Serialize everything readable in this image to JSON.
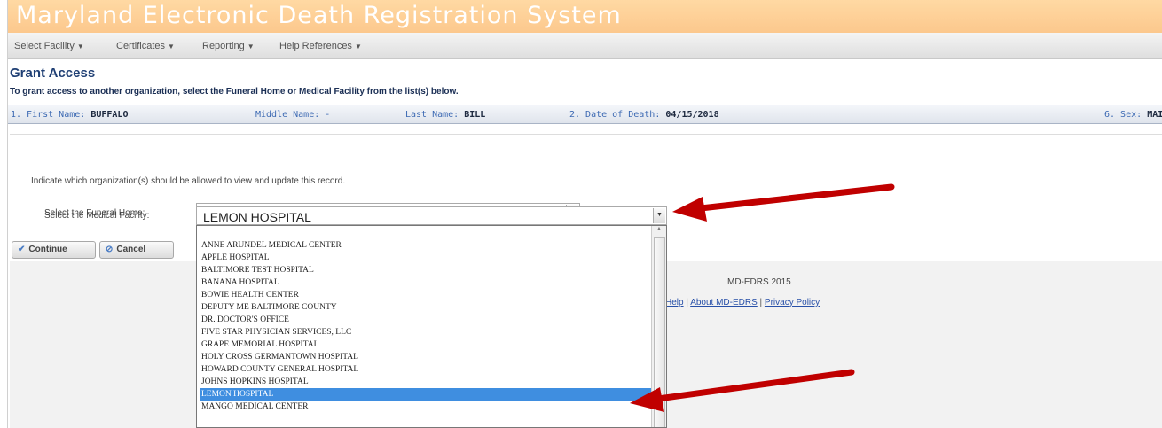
{
  "banner": {
    "title": "Maryland Electronic Death Registration System"
  },
  "menu": [
    {
      "label": "Select Facility"
    },
    {
      "label": "Certificates"
    },
    {
      "label": "Reporting"
    },
    {
      "label": "Help References"
    }
  ],
  "page": {
    "title": "Grant Access",
    "subtitle": "To grant access to another organization, select the Funeral Home or Medical Facility from the list(s) below."
  },
  "decedent": {
    "first_name_label": "1. First Name:",
    "first_name": "BUFFALO",
    "middle_name_label": "Middle Name:",
    "middle_name": "-",
    "last_name_label": "Last Name:",
    "last_name": "BILL",
    "date_of_death_label": "2. Date of Death:",
    "date_of_death": "04/15/2018",
    "sex_label": "6. Sex:",
    "sex": "MAI"
  },
  "form": {
    "instruction": "Indicate which organization(s) should be allowed to view and update this record.",
    "funeral_home_label": "Select the Funeral Home:",
    "funeral_home_value": "",
    "medical_facility_label": "Select the Medical Facility:",
    "medical_facility_value": "LEMON HOSPITAL"
  },
  "buttons": {
    "continue": "Continue",
    "cancel": "Cancel"
  },
  "footer": {
    "text": "MD-EDRS 2015",
    "help": "Help",
    "about": "About MD-EDRS",
    "privacy": "Privacy Policy"
  },
  "dropdown_options": [
    "",
    "ANNE ARUNDEL MEDICAL CENTER",
    "APPLE HOSPITAL",
    "BALTIMORE TEST HOSPITAL",
    "BANANA HOSPITAL",
    "BOWIE HEALTH CENTER",
    "DEPUTY ME BALTIMORE COUNTY",
    "DR. DOCTOR'S OFFICE",
    "FIVE STAR PHYSICIAN SERVICES, LLC",
    "GRAPE MEMORIAL HOSPITAL",
    "HOLY CROSS GERMANTOWN HOSPITAL",
    "HOWARD COUNTY GENERAL HOSPITAL",
    "JOHNS HOPKINS HOSPITAL",
    "LEMON HOSPITAL",
    "MANGO MEDICAL CENTER"
  ],
  "selected_option": "LEMON HOSPITAL",
  "colors": {
    "banner": "#fcc88d",
    "annotation_arrow": "#c00000",
    "selection": "#3f8ee0",
    "title": "#1f3f74"
  }
}
